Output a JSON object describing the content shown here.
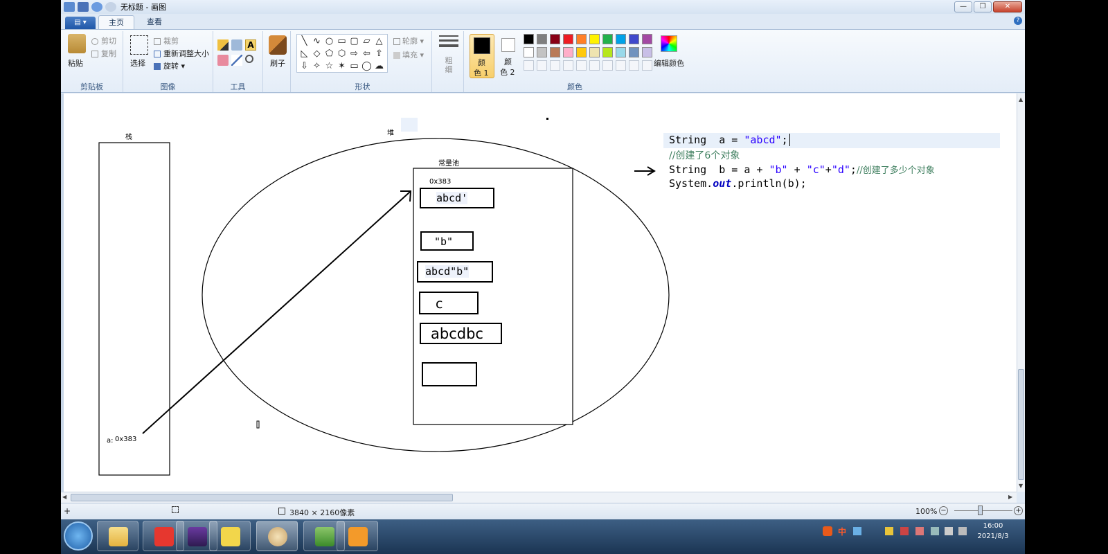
{
  "window": {
    "title": "无标题 - 画图",
    "controls": {
      "minimize": "—",
      "restore": "❐",
      "close": "✕"
    }
  },
  "tabs": {
    "app_menu": "▤ ▾",
    "home": "主页",
    "view": "查看",
    "help": "?"
  },
  "ribbon": {
    "clipboard": {
      "label": "剪贴板",
      "paste": "粘贴",
      "cut": "剪切",
      "copy": "复制"
    },
    "image": {
      "label": "图像",
      "select": "选择",
      "crop": "裁剪",
      "resize": "重新调整大小",
      "rotate": "旋转 ▾"
    },
    "tools": {
      "label": "工具"
    },
    "brushes": {
      "label": "刷子"
    },
    "shapes": {
      "label": "形状",
      "outline": "轮廓 ▾",
      "fill": "填充 ▾"
    },
    "size": {
      "label": "粗细"
    },
    "colors": {
      "label": "颜色",
      "color1": "颜色 1",
      "color1_line1": "颜",
      "color1_line2": "色 1",
      "color2_line1": "颜",
      "color2_line2": "色 2",
      "edit": "编辑颜色",
      "row1": [
        "#000000",
        "#7f7f7f",
        "#880015",
        "#ed1c24",
        "#ff7f27",
        "#fff200",
        "#22b14c",
        "#00a2e8",
        "#3f48cc",
        "#a349a4"
      ],
      "row2": [
        "#ffffff",
        "#c3c3c3",
        "#b97a57",
        "#ffaec9",
        "#ffc90e",
        "#efe4b0",
        "#b5e61d",
        "#99d9ea",
        "#7092be",
        "#c8bfe7"
      ]
    }
  },
  "drawing": {
    "stack_label": "栈",
    "heap_label": "堆",
    "pool_label": "常量池",
    "addr_top": "0x383",
    "var_label": "a:",
    "addr_var": "0x383",
    "boxes": [
      "abcd'",
      "\"b\"",
      "abcd\"b\"",
      "c",
      "abcdbc",
      ""
    ],
    "code_line1_a": "String  a = ",
    "code_line1_str": "\"abcd\"",
    "code_line1_end": ";",
    "code_line2": "//创建了6个对象",
    "code_line3_a": "String  b = a + ",
    "code_line3_b": "\"b\"",
    "code_line3_plus": " + ",
    "code_line3_c": "\"c\"",
    "code_line3_plus2": "+",
    "code_line3_d": "\"d\"",
    "code_line3_semi": ";",
    "code_line3_cm": "//创建了多少个对象",
    "code_line4_a": "System.",
    "code_line4_out": "out",
    "code_line4_b": ".println(b);",
    "arrow": "→"
  },
  "status": {
    "dimensions": "3840 × 2160像素",
    "zoom": "100%"
  },
  "taskbar": {
    "time": "16:00",
    "date": "2021/8/3",
    "ime": "中"
  }
}
